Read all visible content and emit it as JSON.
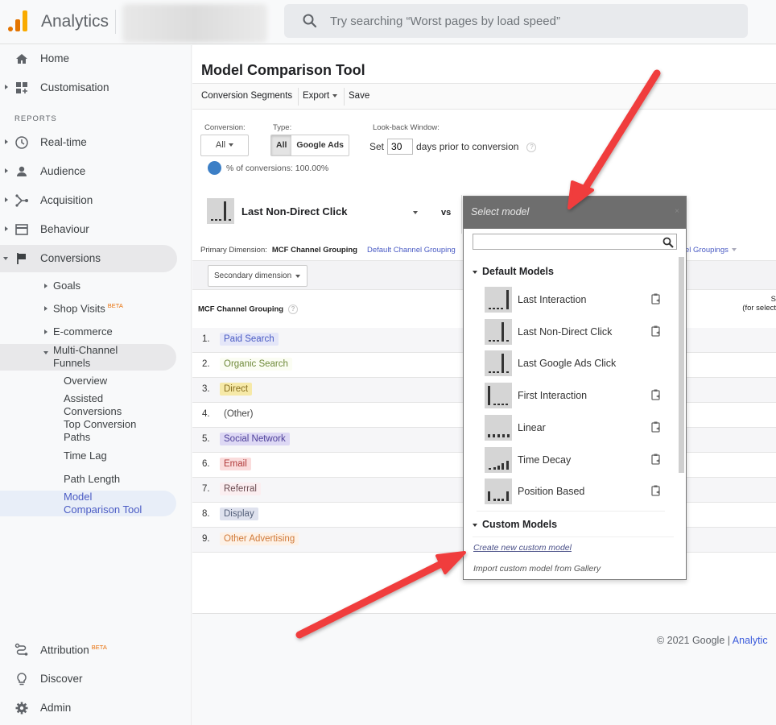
{
  "header": {
    "app_title": "Analytics",
    "search_placeholder": "Try searching “Worst pages by load speed”"
  },
  "sidebar": {
    "home": "Home",
    "customisation": "Customisation",
    "reports_label": "REPORTS",
    "realtime": "Real-time",
    "audience": "Audience",
    "acquisition": "Acquisition",
    "behaviour": "Behaviour",
    "conversions": "Conversions",
    "conversions_sub": {
      "goals": "Goals",
      "shop_visits": "Shop Visits",
      "shop_visits_badge": "BETA",
      "ecommerce": "E-commerce",
      "mcf_line1": "Multi-Channel",
      "mcf_line2": "Funnels"
    },
    "mcf_sub": {
      "overview": "Overview",
      "assisted_line1": "Assisted",
      "assisted_line2": "Conversions",
      "top_paths_line1": "Top Conversion",
      "top_paths_line2": "Paths",
      "time_lag": "Time Lag",
      "path_length": "Path Length",
      "model_comp_line1": "Model",
      "model_comp_line2": "Comparison Tool"
    },
    "attribution": "Attribution",
    "attribution_badge": "BETA",
    "discover": "Discover",
    "admin": "Admin"
  },
  "main": {
    "page_title": "Model Comparison Tool",
    "toolbar": {
      "conversion_segments": "Conversion Segments",
      "export": "Export",
      "save": "Save"
    },
    "filters": {
      "conversion_label": "Conversion:",
      "conversion_value": "All",
      "type_label": "Type:",
      "type_options": [
        "All",
        "Google Ads"
      ],
      "type_selected": "All",
      "lookback_label": "Look-back Window:",
      "lookback_prefix": "Set",
      "lookback_days": "30",
      "lookback_suffix": "days prior to conversion",
      "help": "?",
      "pct_conversions": "% of conversions: 100.00%"
    },
    "model_selected": "Last Non-Direct Click",
    "vs": "vs",
    "primary_dimension_label": "Primary Dimension:",
    "primary_dimension_value": "MCF Channel Grouping",
    "primary_dimension_alt": "Default Channel Grouping",
    "groupings_partial": "el Groupings",
    "secondary_dimension": "Secondary dimension",
    "column_header": "MCF Channel Grouping",
    "right_col_line1": "S",
    "right_col_line2": "(for select",
    "rows": [
      {
        "num": "1.",
        "channel": "Paid Search",
        "bg": "#e4e6f8",
        "fg": "#4a5bc4"
      },
      {
        "num": "2.",
        "channel": "Organic Search",
        "bg": "#fbfdf3",
        "fg": "#6f8a3a"
      },
      {
        "num": "3.",
        "channel": "Direct",
        "bg": "#f6e9a8",
        "fg": "#8a7020"
      },
      {
        "num": "4.",
        "channel": "(Other)",
        "bg": "transparent",
        "fg": "#444444"
      },
      {
        "num": "5.",
        "channel": "Social Network",
        "bg": "#ddd8f4",
        "fg": "#4d3f9a"
      },
      {
        "num": "6.",
        "channel": "Email",
        "bg": "#fadcdc",
        "fg": "#b03a3a"
      },
      {
        "num": "7.",
        "channel": "Referral",
        "bg": "#fbeef0",
        "fg": "#6a4a50"
      },
      {
        "num": "8.",
        "channel": "Display",
        "bg": "#dfe2ee",
        "fg": "#55607a"
      },
      {
        "num": "9.",
        "channel": "Other Advertising",
        "bg": "#fdf1e6",
        "fg": "#d07a3a"
      }
    ],
    "footer_copyright": "© 2021 Google |",
    "footer_link": "Analytic"
  },
  "dropdown": {
    "title": "Select model",
    "close": "×",
    "default_section": "Default Models",
    "default_models": [
      {
        "name": "Last Interaction",
        "copy": true
      },
      {
        "name": "Last Non-Direct Click",
        "copy": true
      },
      {
        "name": "Last Google Ads Click",
        "copy": false
      },
      {
        "name": "First Interaction",
        "copy": true
      },
      {
        "name": "Linear",
        "copy": true
      },
      {
        "name": "Time Decay",
        "copy": true
      },
      {
        "name": "Position Based",
        "copy": true
      }
    ],
    "custom_section": "Custom Models",
    "create_link": "Create new custom model",
    "import_link": "Import custom model from Gallery"
  },
  "colors": {
    "annotation_arrow": "#f03c3c",
    "link": "#4a5bc4",
    "dropdown_header": "#6e6e6e"
  }
}
